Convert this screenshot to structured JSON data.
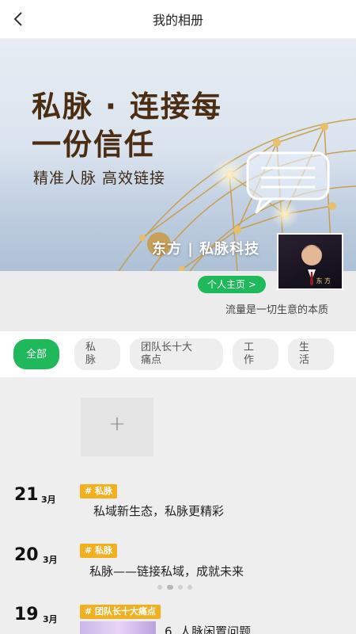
{
  "header": {
    "title": "我的相册"
  },
  "banner": {
    "title_line1": "私脉 · 连接每",
    "title_line2": "一份信任",
    "subtitle": "精准人脉 高效链接",
    "brand": "东方 | 私脉科技",
    "avatar_caption": "东 方"
  },
  "profile": {
    "home_button": "个人主页 >",
    "tagline": "流量是一切生意的本质"
  },
  "filters": [
    {
      "label": "全部",
      "active": true
    },
    {
      "label": "私\n脉",
      "active": false
    },
    {
      "label": "团队长十大\n痛点",
      "active": false
    },
    {
      "label": "工\n作",
      "active": false
    },
    {
      "label": "生\n活",
      "active": false
    }
  ],
  "add_tile": {
    "glyph": "+"
  },
  "entries": [
    {
      "day": "21",
      "month": "3月",
      "tag": "# 私脉",
      "text": "私域新生态，私脉更精彩"
    },
    {
      "day": "20",
      "month": "3月",
      "tag": "# 私脉",
      "text": "私脉——链接私域，成就未来"
    },
    {
      "day": "19",
      "month": "3月",
      "tag": "# 团队长十大痛点",
      "text": "6. 人脉闲置问题"
    }
  ],
  "colors": {
    "accent_green": "#1fb85a",
    "tag_orange": "#f0b020",
    "banner_text": "#4a2d12"
  }
}
